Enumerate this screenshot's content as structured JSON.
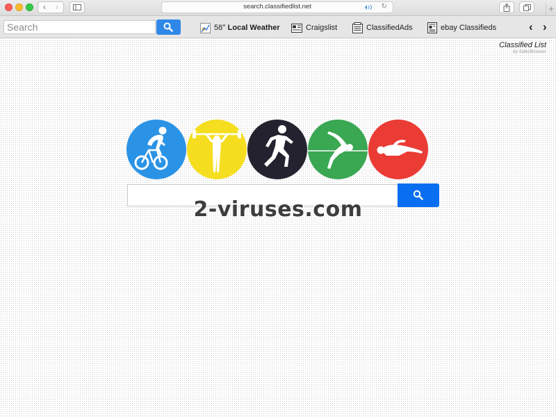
{
  "browser": {
    "url": "search.classifiedlist.net",
    "nav_back": "‹",
    "nav_forward": "›",
    "reload": "↻",
    "new_tab": "+"
  },
  "toolbar": {
    "search_placeholder": "Search",
    "links": [
      {
        "temp": "58°",
        "label": "Local Weather",
        "icon": "weather-icon"
      },
      {
        "label": "Craigslist",
        "icon": "newspaper-icon"
      },
      {
        "label": "ClassifiedAds",
        "icon": "newspaper-icon"
      },
      {
        "label": "ebay Classifieds",
        "icon": "newspaper-icon"
      }
    ],
    "arrow_left": "‹",
    "arrow_right": "›"
  },
  "brand": {
    "title": "Classified List",
    "subtitle": "by SaferBrowser"
  },
  "sports": [
    {
      "name": "cycling",
      "color": "#2a93e6"
    },
    {
      "name": "weightlifting",
      "color": "#f5de1f"
    },
    {
      "name": "running",
      "color": "#23222e"
    },
    {
      "name": "high-jump",
      "color": "#3aa753"
    },
    {
      "name": "swimming",
      "color": "#ea3b35"
    }
  ],
  "main": {
    "search_value": "",
    "accent": "#0a6ef0"
  },
  "watermark": "2-viruses.com"
}
